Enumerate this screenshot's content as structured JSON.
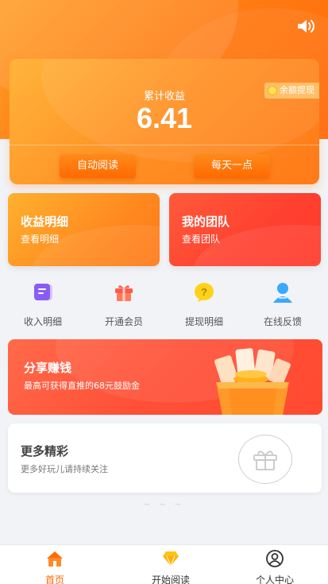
{
  "colors": {
    "accent": "#ff6a00",
    "orange": "#ff9024",
    "red": "#ff4a30"
  },
  "header": {
    "sound_icon": "speaker-icon"
  },
  "earnings": {
    "title": "累计收益",
    "value": "6.41",
    "withdraw_label": "余额提现",
    "auto_read_label": "自动阅读",
    "daily_label": "每天一点"
  },
  "cards": {
    "income": {
      "title": "收益明细",
      "subtitle": "查看明细"
    },
    "team": {
      "title": "我的团队",
      "subtitle": "查看团队"
    }
  },
  "quick_actions": [
    {
      "label": "收入明细",
      "icon": "document-icon"
    },
    {
      "label": "开通会员",
      "icon": "gift-box-icon"
    },
    {
      "label": "提现明细",
      "icon": "question-bubble-icon"
    },
    {
      "label": "在线反馈",
      "icon": "user-icon"
    }
  ],
  "share": {
    "title": "分享赚钱",
    "subtitle": "最高可获得直推的68元鼓励金"
  },
  "more": {
    "title": "更多精彩",
    "subtitle": "更多好玩儿请持续关注"
  },
  "footer_dots": "~ ~ ~",
  "tabs": [
    {
      "label": "首页",
      "icon": "home-icon"
    },
    {
      "label": "开始阅读",
      "icon": "diamond-icon"
    },
    {
      "label": "个人中心",
      "icon": "profile-icon"
    }
  ]
}
